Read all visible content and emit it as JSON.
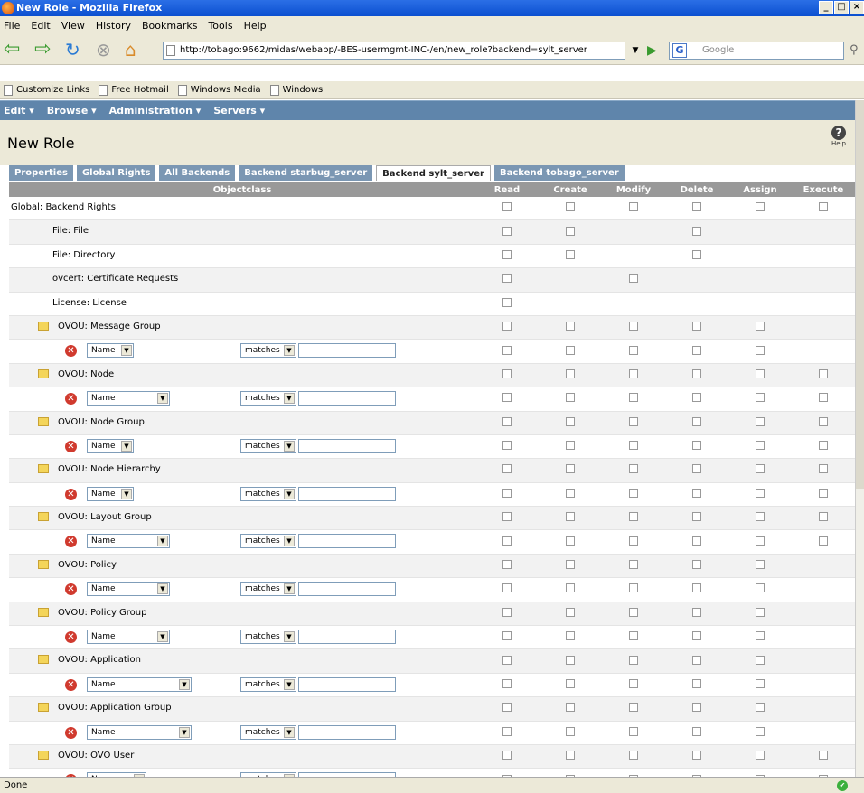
{
  "window": {
    "title": "New Role - Mozilla Firefox"
  },
  "menubar": [
    "File",
    "Edit",
    "View",
    "History",
    "Bookmarks",
    "Tools",
    "Help"
  ],
  "nav": {
    "url": "http://tobago:9662/midas/webapp/-BES-usermgmt-INC-/en/new_role?backend=sylt_server",
    "search_placeholder": "Google"
  },
  "bookmarks": [
    "Customize Links",
    "Free Hotmail",
    "Windows Media",
    "Windows"
  ],
  "appmenu": [
    "Edit ▾",
    "Browse ▾",
    "Administration ▾",
    "Servers ▾"
  ],
  "page": {
    "title": "New Role",
    "help": "Help"
  },
  "tabs": [
    "Properties",
    "Global Rights",
    "All Backends",
    "Backend starbug_server",
    "Backend sylt_server",
    "Backend tobago_server"
  ],
  "active_tab": "Backend sylt_server",
  "table": {
    "headers": [
      "Objectclass",
      "Read",
      "Create",
      "Modify",
      "Delete",
      "Assign",
      "Execute"
    ],
    "rows": [
      {
        "label": "Global: Backend Rights",
        "type": "plain",
        "indent": 0,
        "cb": [
          1,
          1,
          1,
          1,
          1,
          1
        ]
      },
      {
        "label": "File: File",
        "type": "plain",
        "indent": 1,
        "cb": [
          1,
          1,
          0,
          1,
          0,
          0
        ]
      },
      {
        "label": "File: Directory",
        "type": "plain",
        "indent": 1,
        "cb": [
          1,
          1,
          0,
          1,
          0,
          0
        ]
      },
      {
        "label": "ovcert: Certificate Requests",
        "type": "plain",
        "indent": 1,
        "cb": [
          1,
          0,
          1,
          0,
          0,
          0
        ]
      },
      {
        "label": "License: License",
        "type": "plain",
        "indent": 1,
        "cb": [
          1,
          0,
          0,
          0,
          0,
          0
        ]
      },
      {
        "label": "OVOU: Message Group",
        "type": "folder",
        "cb": [
          1,
          1,
          1,
          1,
          1,
          0
        ]
      },
      {
        "type": "filter",
        "sel": "Name",
        "op": "matches",
        "w": 52,
        "cb": [
          1,
          1,
          1,
          1,
          1,
          0
        ]
      },
      {
        "label": "OVOU: Node",
        "type": "folder",
        "cb": [
          1,
          1,
          1,
          1,
          1,
          1
        ]
      },
      {
        "type": "filter",
        "sel": "Name",
        "op": "matches",
        "w": 92,
        "cb": [
          1,
          1,
          1,
          1,
          1,
          1
        ]
      },
      {
        "label": "OVOU: Node Group",
        "type": "folder",
        "cb": [
          1,
          1,
          1,
          1,
          1,
          1
        ]
      },
      {
        "type": "filter",
        "sel": "Name",
        "op": "matches",
        "w": 52,
        "cb": [
          1,
          1,
          1,
          1,
          1,
          1
        ]
      },
      {
        "label": "OVOU: Node Hierarchy",
        "type": "folder",
        "cb": [
          1,
          1,
          1,
          1,
          1,
          1
        ]
      },
      {
        "type": "filter",
        "sel": "Name",
        "op": "matches",
        "w": 52,
        "cb": [
          1,
          1,
          1,
          1,
          1,
          1
        ]
      },
      {
        "label": "OVOU: Layout Group",
        "type": "folder",
        "cb": [
          1,
          1,
          1,
          1,
          1,
          1
        ]
      },
      {
        "type": "filter",
        "sel": "Name",
        "op": "matches",
        "w": 92,
        "cb": [
          1,
          1,
          1,
          1,
          1,
          1
        ]
      },
      {
        "label": "OVOU: Policy",
        "type": "folder",
        "cb": [
          1,
          1,
          1,
          1,
          1,
          0
        ]
      },
      {
        "type": "filter",
        "sel": "Name",
        "op": "matches",
        "w": 92,
        "cb": [
          1,
          1,
          1,
          1,
          1,
          0
        ]
      },
      {
        "label": "OVOU: Policy Group",
        "type": "folder",
        "cb": [
          1,
          1,
          1,
          1,
          1,
          0
        ]
      },
      {
        "type": "filter",
        "sel": "Name",
        "op": "matches",
        "w": 92,
        "cb": [
          1,
          1,
          1,
          1,
          1,
          0
        ]
      },
      {
        "label": "OVOU: Application",
        "type": "folder",
        "cb": [
          1,
          1,
          1,
          1,
          1,
          0
        ]
      },
      {
        "type": "filter",
        "sel": "Name",
        "op": "matches",
        "w": 116,
        "cb": [
          1,
          1,
          1,
          1,
          1,
          0
        ]
      },
      {
        "label": "OVOU: Application Group",
        "type": "folder",
        "cb": [
          1,
          1,
          1,
          1,
          1,
          0
        ]
      },
      {
        "type": "filter",
        "sel": "Name",
        "op": "matches",
        "w": 116,
        "cb": [
          1,
          1,
          1,
          1,
          1,
          0
        ]
      },
      {
        "label": "OVOU: OVO User",
        "type": "folder",
        "cb": [
          1,
          1,
          1,
          1,
          1,
          1
        ]
      },
      {
        "type": "filter",
        "sel": "Name",
        "op": "matches",
        "w": 66,
        "cb": [
          1,
          1,
          1,
          1,
          1,
          1
        ]
      }
    ]
  },
  "status": "Done"
}
